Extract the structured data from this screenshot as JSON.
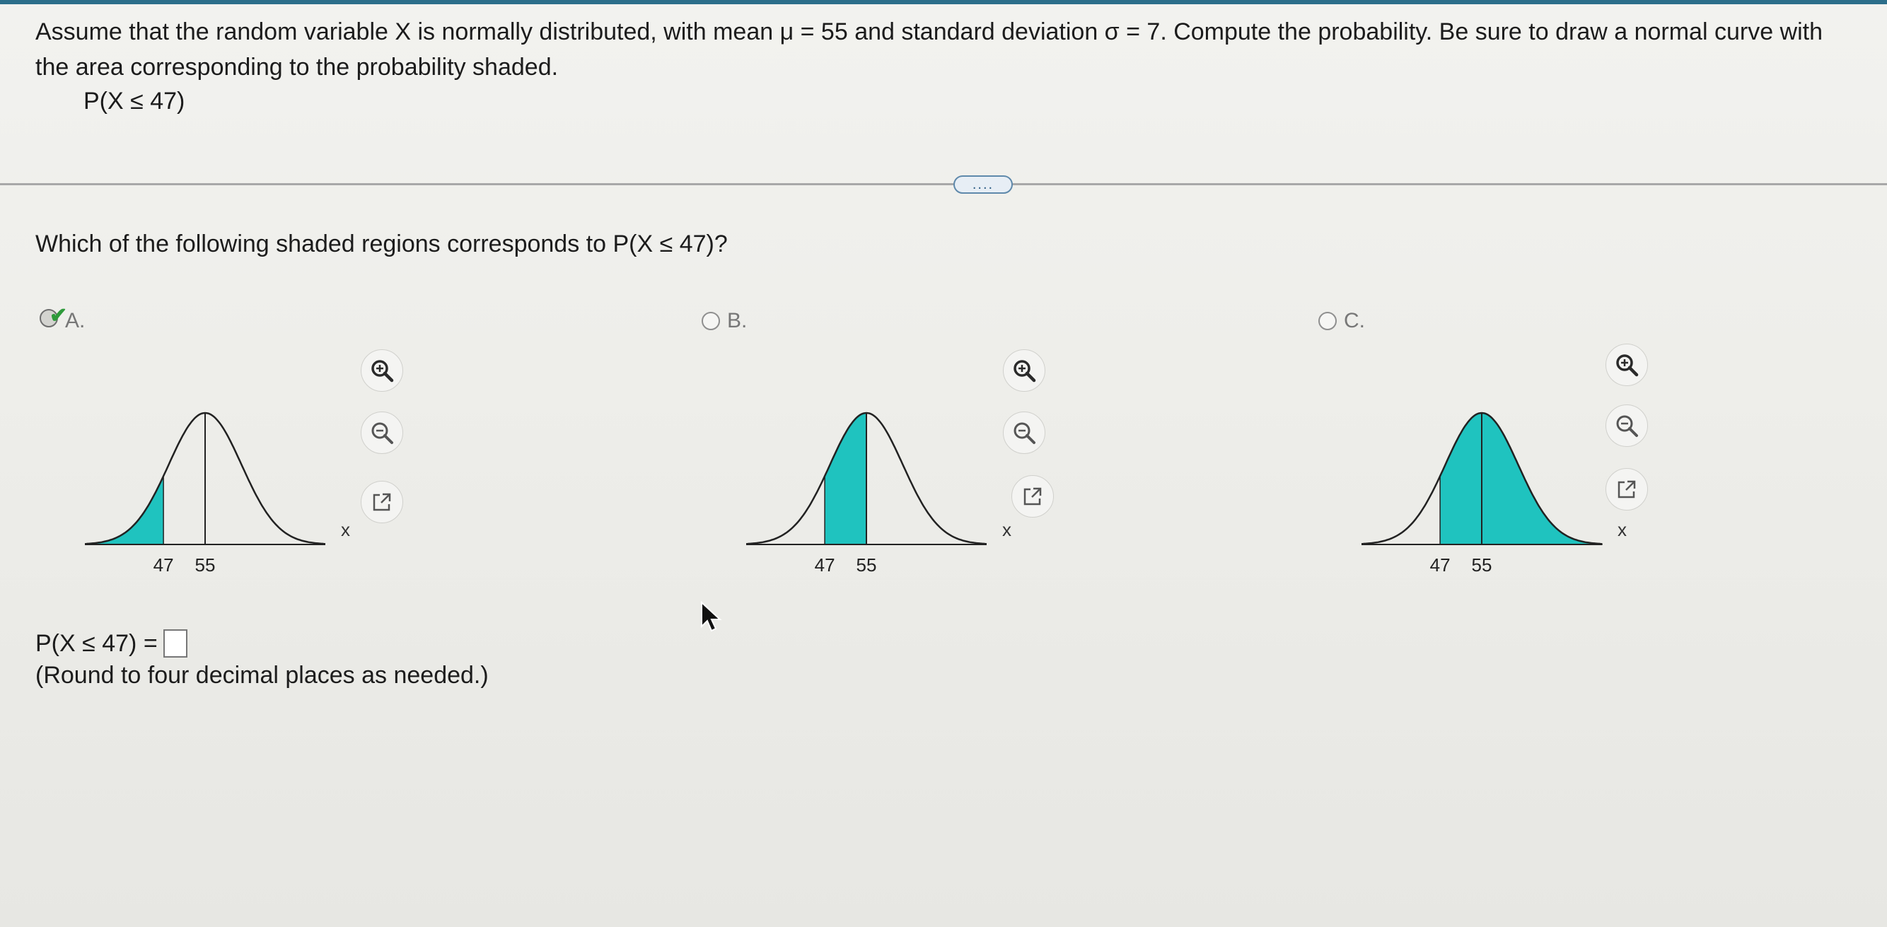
{
  "question": {
    "text": "Assume that the random variable X is normally distributed, with mean μ = 55 and standard deviation σ = 7. Compute the probability. Be sure to draw a normal curve with the area corresponding to the probability shaded.",
    "expression": "P(X ≤ 47)"
  },
  "expand_label": "....",
  "sub_question": "Which of the following shaded regions corresponds to P(X ≤ 47)?",
  "options": [
    {
      "label": "A.",
      "selected": true,
      "correct": true,
      "shade": "left",
      "ticks": [
        "47",
        "55"
      ],
      "axis_label": "x"
    },
    {
      "label": "B.",
      "selected": false,
      "shade": "between",
      "ticks": [
        "47",
        "55"
      ],
      "axis_label": "x"
    },
    {
      "label": "C.",
      "selected": false,
      "shade": "right",
      "ticks": [
        "47",
        "55"
      ],
      "axis_label": "x"
    }
  ],
  "tools": [
    "zoom-in-icon",
    "zoom-out-icon",
    "open-new-window-icon"
  ],
  "answer": {
    "prompt": "P(X ≤ 47) =",
    "value": "",
    "note": "(Round to four decimal places as needed.)"
  },
  "colors": {
    "shade": "#1fc3bf",
    "curve": "#222222",
    "check": "#2e9a3a",
    "accent": "#2c6e8a"
  }
}
